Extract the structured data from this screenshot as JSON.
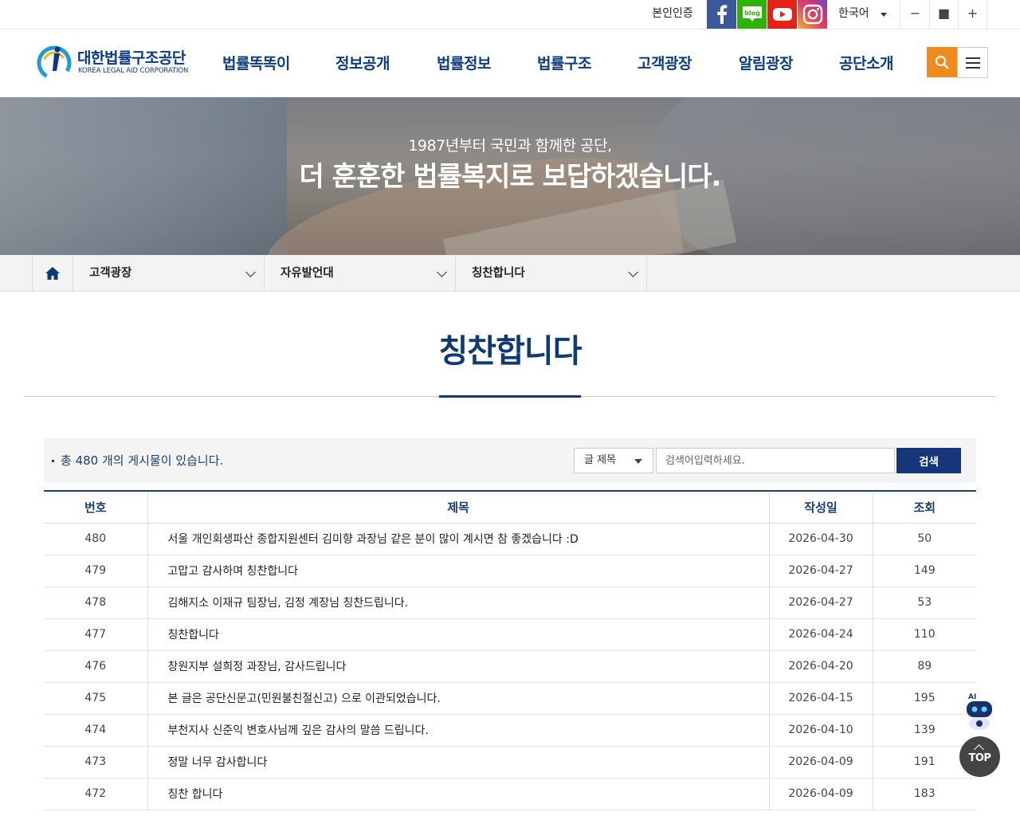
{
  "util": {
    "verify": "본인인증",
    "sns": [
      "facebook-icon",
      "blog-icon",
      "youtube-icon",
      "instagram-icon"
    ],
    "blog_text": "blog",
    "language": "한국어",
    "zoom_out": "−",
    "zoom_reset": "■",
    "zoom_in": "+"
  },
  "header": {
    "logo_ko": "대한법률구조공단",
    "logo_en": "KOREA LEGAL AID CORPORATION",
    "nav": [
      "법률똑똑이",
      "정보공개",
      "법률정보",
      "법률구조",
      "고객광장",
      "알림광장",
      "공단소개"
    ]
  },
  "hero": {
    "sub": "1987년부터 국민과 함께한 공단,",
    "main": "더 훈훈한 법률복지로 보답하겠습니다."
  },
  "breadcrumb": [
    "고객광장",
    "자유발언대",
    "칭찬합니다"
  ],
  "page_title": "칭찬합니다",
  "board": {
    "total_text": "총 480 개의 게시물이 있습니다.",
    "search_field": "글 제목",
    "search_placeholder": "검색어입력하세요.",
    "search_button": "검색",
    "columns": [
      "번호",
      "제목",
      "작성일",
      "조회"
    ],
    "rows": [
      {
        "no": "480",
        "title": "서울 개인회생파산 종합지원센터 김미향 과장님 같은 분이 많이 계시면 참 좋겠습니다 :D",
        "date": "2026-04-30",
        "views": "50"
      },
      {
        "no": "479",
        "title": "고맙고 감사하며 칭찬합니다",
        "date": "2026-04-27",
        "views": "149"
      },
      {
        "no": "478",
        "title": "김해지소 이재규 팀장님, 김정 계장님 칭찬드립니다.",
        "date": "2026-04-27",
        "views": "53"
      },
      {
        "no": "477",
        "title": "칭찬합니다",
        "date": "2026-04-24",
        "views": "110"
      },
      {
        "no": "476",
        "title": "창원지부 설희정 과장님, 감사드립니다",
        "date": "2026-04-20",
        "views": "89"
      },
      {
        "no": "475",
        "title": "본 글은 공단신문고(민원불친절신고) 으로 이관되었습니다.",
        "date": "2026-04-15",
        "views": "195"
      },
      {
        "no": "474",
        "title": "부천지사 신준익 변호사님께 깊은 감사의 말씀 드립니다.",
        "date": "2026-04-10",
        "views": "139"
      },
      {
        "no": "473",
        "title": "정말 너무 감사합니다",
        "date": "2026-04-09",
        "views": "191"
      },
      {
        "no": "472",
        "title": "칭찬 합니다",
        "date": "2026-04-09",
        "views": "183"
      }
    ]
  },
  "floating": {
    "ai_label": "AI",
    "top_label": "TOP"
  },
  "colors": {
    "brand_navy": "#0f3b74",
    "search_orange": "#f08a1d",
    "search_button": "#15367a"
  }
}
